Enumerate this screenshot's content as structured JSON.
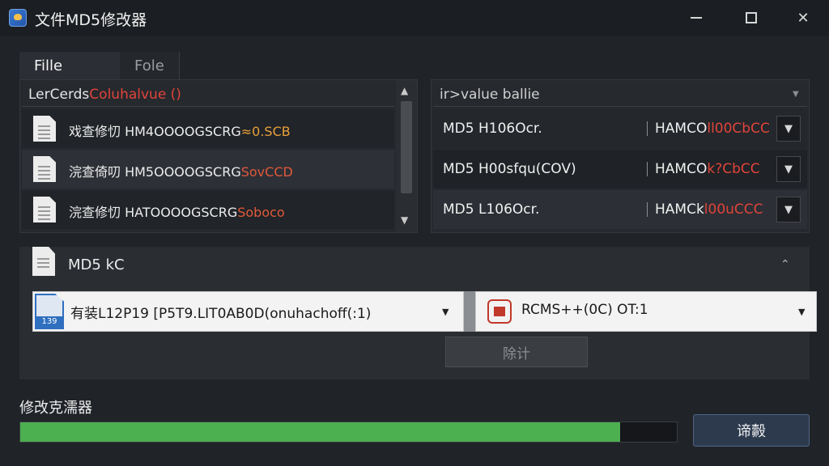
{
  "window": {
    "title": "文件MD5修改器",
    "controls": {
      "minimize": "minimize",
      "maximize": "maximize",
      "close": "✕"
    }
  },
  "tabs": [
    {
      "label": "Fille",
      "active": true
    },
    {
      "label": "Fole",
      "active": false
    }
  ],
  "file_list": {
    "header_prefix": "LerCerds",
    "header_accent": "Coluhalvue ()",
    "rows": [
      {
        "name": "戏查修忉 HM4OOOOGSCRG",
        "accent": "≈0.SCB"
      },
      {
        "name": "浣查倚叨 HM5OOOOGSCRG",
        "accent": "SovCCD"
      },
      {
        "name": "浣查修忉 HATOOOOGSCRG",
        "accent": "Soboco"
      }
    ]
  },
  "md5_list": {
    "header": "ir>value ballie",
    "rows": [
      {
        "label": "MD5 H106Ocr.",
        "value": "HAMCO",
        "accent": "ll00CbCC"
      },
      {
        "label": "MD5 H00sfqu(COV)",
        "value": "HAMCO",
        "accent": "k?CbCC"
      },
      {
        "label": "MD5 L106Ocr.",
        "value": "HAMCk",
        "accent": "l00uCCC"
      }
    ]
  },
  "md5_panel": {
    "title": "MD5 kC",
    "left_select": {
      "icon_tag": "139",
      "value": "有装L12P19 [P5T9.LIT0AB0D(onuhachoff(:1)"
    },
    "right_select": {
      "value": "RCMS++(0C) OT:1"
    },
    "action_button": "除计"
  },
  "progress": {
    "label": "修改克濡器",
    "value": 0.914
  },
  "primary_button": "谛㲉",
  "colors": {
    "accent_red": "#e0443a",
    "progress_green": "#4caf50",
    "primary_button_bg": "#2d3a4e"
  }
}
